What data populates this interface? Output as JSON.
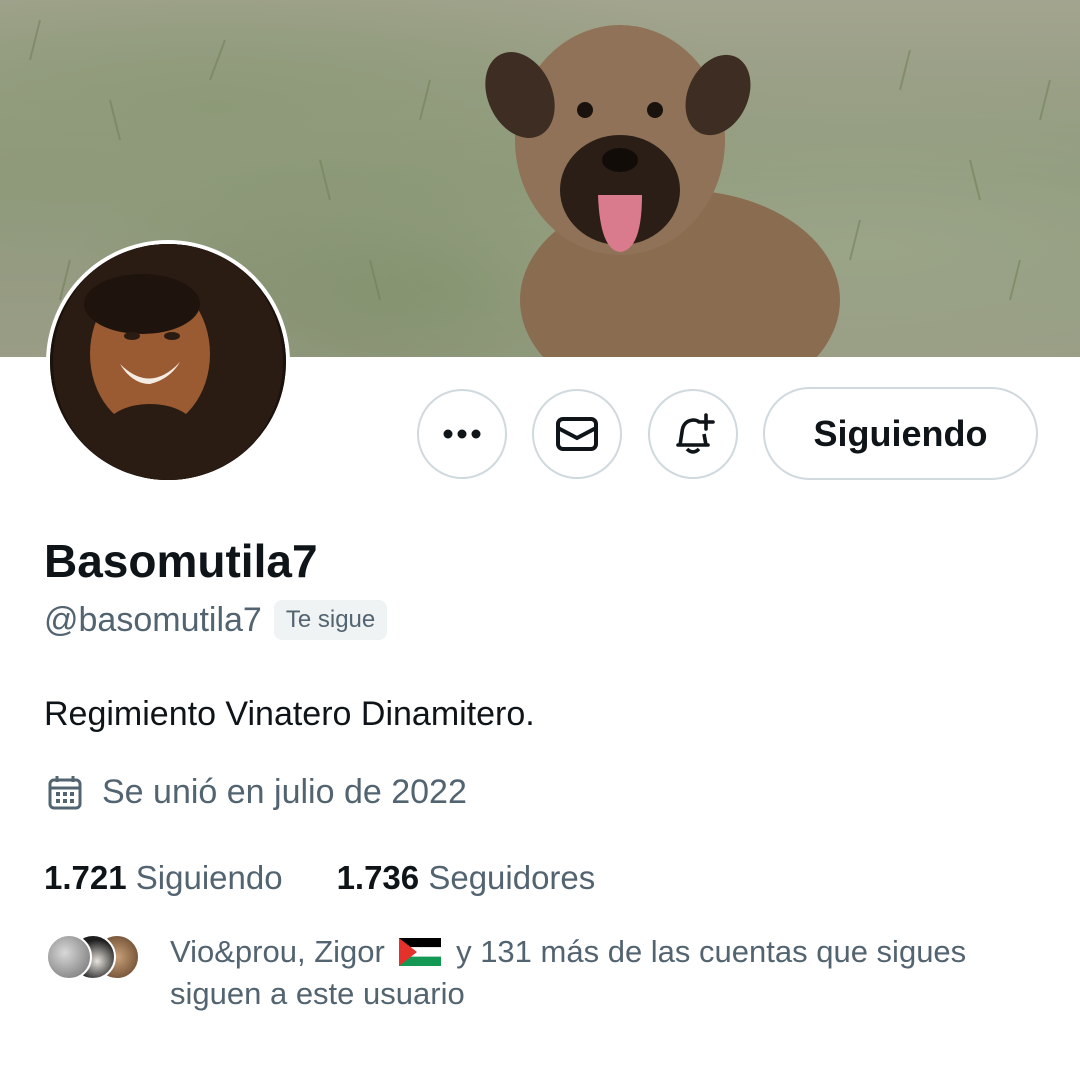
{
  "profile": {
    "display_name": "Basomutila7",
    "handle": "@basomutila7",
    "follows_you_badge": "Te sigue",
    "bio": "Regimiento Vinatero Dinamitero.",
    "joined": "Se unió en julio de 2022",
    "joined_icon": "calendar-icon"
  },
  "actions": {
    "more_icon": "ellipsis-icon",
    "message_icon": "mail-icon",
    "notify_icon": "bell-plus-icon",
    "follow_label": "Siguiendo"
  },
  "stats": {
    "following_count": "1.721",
    "following_label": "Siguiendo",
    "followers_count": "1.736",
    "followers_label": "Seguidores"
  },
  "followers_you_know": {
    "text_before_flag": "Vio&prou, Zigor",
    "flag_icon": "palestine-flag-icon",
    "text_after_flag": "y 131 más de las cuentas que sigues siguen a este usuario"
  },
  "colors": {
    "text_primary": "#0f1419",
    "text_secondary": "#536471",
    "border": "#cfd9de",
    "badge_bg": "#eff3f4"
  }
}
